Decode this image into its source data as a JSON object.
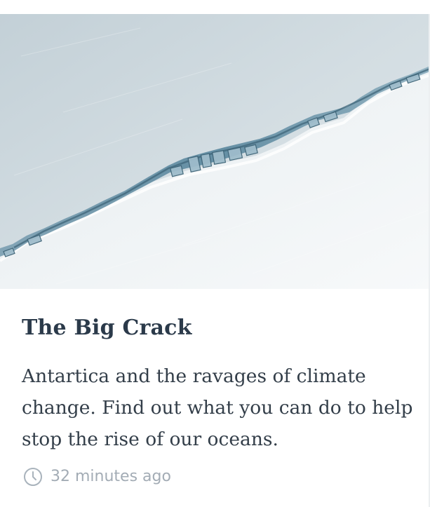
{
  "card": {
    "image_alt": "Aerial view of a long crack across an Antarctic ice shelf",
    "title": "The Big Crack",
    "description": "Antartica and the ravages of climate change. Find out what you can do to help stop the rise of our oceans.",
    "timestamp": "32 minutes ago",
    "timestamp_icon": "clock-icon"
  },
  "colors": {
    "title": "#2b3a4a",
    "body_text": "#333e49",
    "meta_text": "#a3acb5"
  }
}
